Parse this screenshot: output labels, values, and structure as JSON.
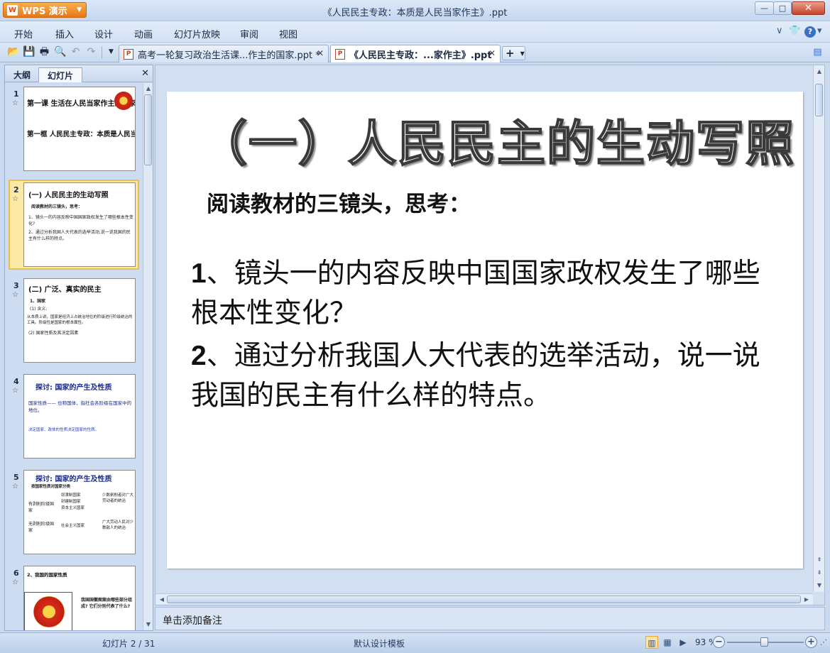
{
  "app": {
    "name": "WPS 演示",
    "logo_letter": "W"
  },
  "window": {
    "title": "《人民民主专政：本质是人民当家作主》.ppt",
    "min_glyph": "—",
    "max_glyph": "□",
    "close_glyph": "✕"
  },
  "menu": {
    "items": [
      "开始",
      "插入",
      "设计",
      "动画",
      "幻灯片放映",
      "审阅",
      "视图"
    ],
    "right": {
      "expand": "∨",
      "skin": "👕",
      "help": "?"
    }
  },
  "toolbar": {
    "tabs": [
      {
        "label": "高考一轮复习政治生活课...作主的国家.ppt *",
        "active": false
      },
      {
        "label": "《人民民主专政：...家作主》.ppt",
        "active": true
      }
    ],
    "new_tab": "+"
  },
  "left_panel": {
    "tabs": [
      "大纲",
      "幻灯片"
    ],
    "active_tab": "幻灯片",
    "close": "✕",
    "slides": [
      {
        "num": "1",
        "lines": [
          "第一课 生活在人民当家作主的国家",
          "第一框 人民民主专政：本质是人民当家作主"
        ]
      },
      {
        "num": "2",
        "lines": [
          "(一) 人民民主的生动写照",
          "阅读教材的三镜头，思考：",
          "1、镜头一的内容反映中国国家政权发生了哪些根本性变化?",
          "2、通过分析我国人大代表的选举活动,说一说我国的民主有什么样的特点。"
        ]
      },
      {
        "num": "3",
        "lines": [
          "(二) 广泛、真实的民主",
          "1、国家",
          "(1) 含义:",
          "从本质上讲，国家是经济上占统治地位的阶级进行阶级统治的工具。阶级性是国家的根本属性。",
          "(2) 国家性质及其决定因素"
        ]
      },
      {
        "num": "4",
        "lines": [
          "探讨: 国家的产生及性质",
          "国家性质—— 也称国体，指社会各阶级在国家中的地位。",
          "决定国家、政体的性质决定国家的性质。"
        ]
      },
      {
        "num": "5",
        "lines": [
          "探讨: 国家的产生及性质",
          "按国家性质对国家分类",
          "有剥削阶级国家",
          "无剥削阶级国家",
          "奴隶制国家",
          "封建制国家",
          "资本主义国家",
          "社会主义国家",
          "少数剥削者对广大劳动者的统治",
          "广大劳动人民对少数敌人的统治"
        ]
      },
      {
        "num": "6",
        "lines": [
          "2、我国的国家性质",
          "我国国徽图案由哪些部分组成? 它们分别代表了什么?"
        ]
      }
    ]
  },
  "slide": {
    "title": "（一）人民民主的生动写照",
    "subtitle": "阅读教材的三镜头，思考：",
    "q1_num": "1",
    "q1_text": "、镜头一的内容反映中国国家政权发生了哪些根本性变化？",
    "q2_num": "2",
    "q2_text": "、通过分析我国人大代表的选举活动，说一说我国的民主有什么样的特点。"
  },
  "notes": {
    "placeholder": "单击添加备注"
  },
  "status": {
    "slide_info": "幻灯片 2 / 31",
    "template": "默认设计模板",
    "zoom_label": "93 %",
    "zoom_value": 93
  },
  "colors": {
    "accent_orange": "#e6771a",
    "selection": "#fde9a6",
    "chrome_blue": "#c9daf0",
    "thumb_title_navy": "#1a2a8a"
  }
}
